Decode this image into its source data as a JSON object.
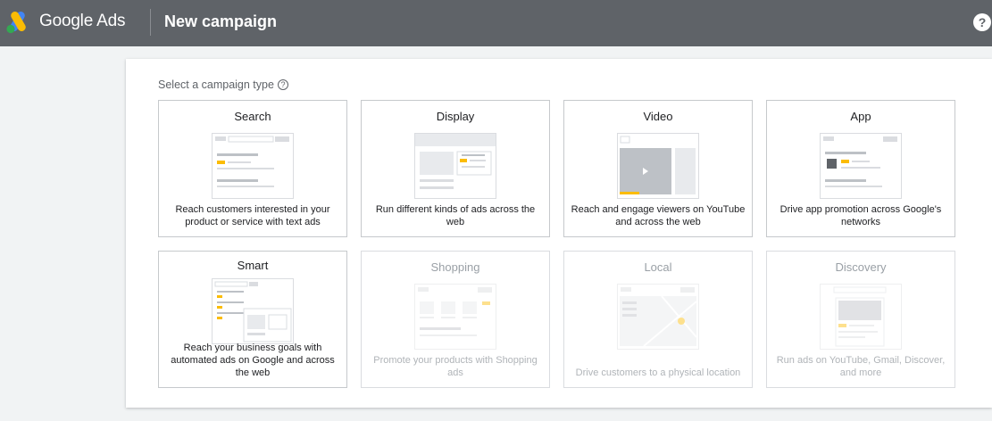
{
  "header": {
    "brand": "Google Ads",
    "page_title": "New campaign",
    "help_label": "?"
  },
  "main": {
    "select_label": "Select a campaign type",
    "help_glyph": "?",
    "campaign_types": [
      {
        "title": "Search",
        "description": "Reach customers interested in your product or service with text ads",
        "enabled": true,
        "icon": "search-illustration"
      },
      {
        "title": "Display",
        "description": "Run different kinds of ads across the web",
        "enabled": true,
        "icon": "display-illustration"
      },
      {
        "title": "Video",
        "description": "Reach and engage viewers on YouTube and across the web",
        "enabled": true,
        "icon": "video-illustration"
      },
      {
        "title": "App",
        "description": "Drive app promotion across Google's networks",
        "enabled": true,
        "icon": "app-illustration"
      },
      {
        "title": "Smart",
        "description": "Reach your business goals with automated ads on Google and across the web",
        "enabled": true,
        "icon": "smart-illustration"
      },
      {
        "title": "Shopping",
        "description": "Promote your products with Shopping ads",
        "enabled": false,
        "icon": "shopping-illustration"
      },
      {
        "title": "Local",
        "description": "Drive customers to a physical location",
        "enabled": false,
        "icon": "local-illustration"
      },
      {
        "title": "Discovery",
        "description": "Run ads on YouTube, Gmail, Discover, and more",
        "enabled": false,
        "icon": "discovery-illustration"
      }
    ]
  },
  "colors": {
    "topbar": "#5f6368",
    "accent_yellow": "#fbbc04",
    "logo_blue": "#4285f4",
    "logo_green": "#34a853"
  }
}
